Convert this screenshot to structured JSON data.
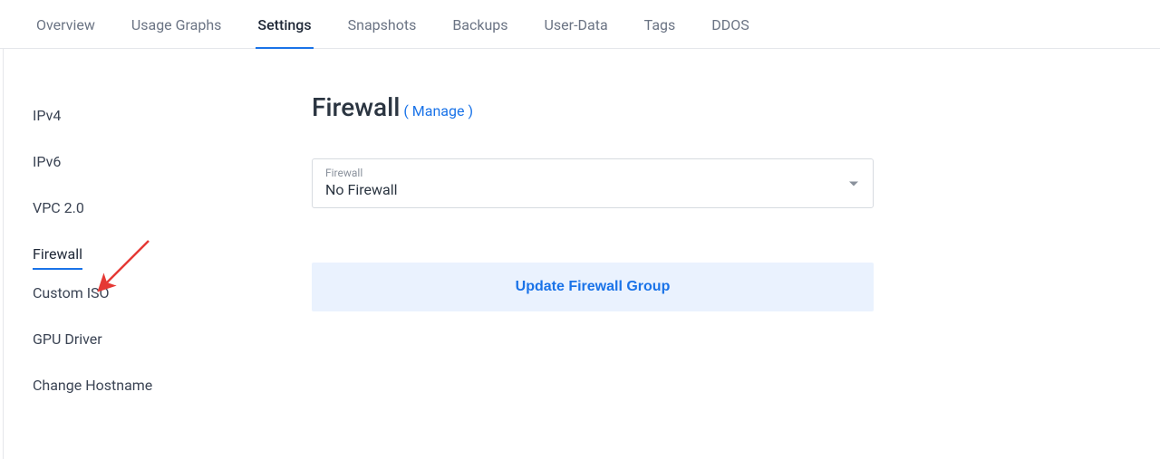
{
  "tabs": {
    "overview": "Overview",
    "usage_graphs": "Usage Graphs",
    "settings": "Settings",
    "snapshots": "Snapshots",
    "backups": "Backups",
    "user_data": "User-Data",
    "tags": "Tags",
    "ddos": "DDOS"
  },
  "sidebar": {
    "ipv4": "IPv4",
    "ipv6": "IPv6",
    "vpc": "VPC 2.0",
    "firewall": "Firewall",
    "custom_iso": "Custom ISO",
    "gpu_driver": "GPU Driver",
    "change_hostname": "Change Hostname"
  },
  "main": {
    "title": "Firewall",
    "manage_link": "( Manage )",
    "select_label": "Firewall",
    "select_value": "No Firewall",
    "update_button": "Update Firewall Group"
  },
  "annotation": {
    "arrow_color": "#e53935"
  }
}
